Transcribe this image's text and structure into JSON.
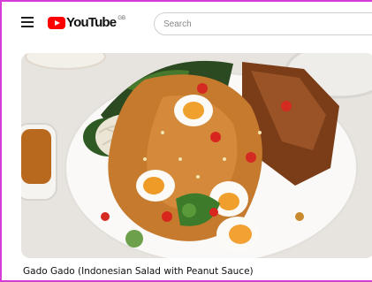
{
  "header": {
    "menu_icon": "hamburger-menu-icon",
    "logo": {
      "text": "YouTube",
      "region": "GB",
      "icon": "youtube-play-icon",
      "brand_color": "#ff0000"
    },
    "search": {
      "placeholder": "Search",
      "value": ""
    }
  },
  "video": {
    "title": "Gado Gado (Indonesian Salad with Peanut Sauce)",
    "thumbnail": "gado-gado-salad-image"
  }
}
